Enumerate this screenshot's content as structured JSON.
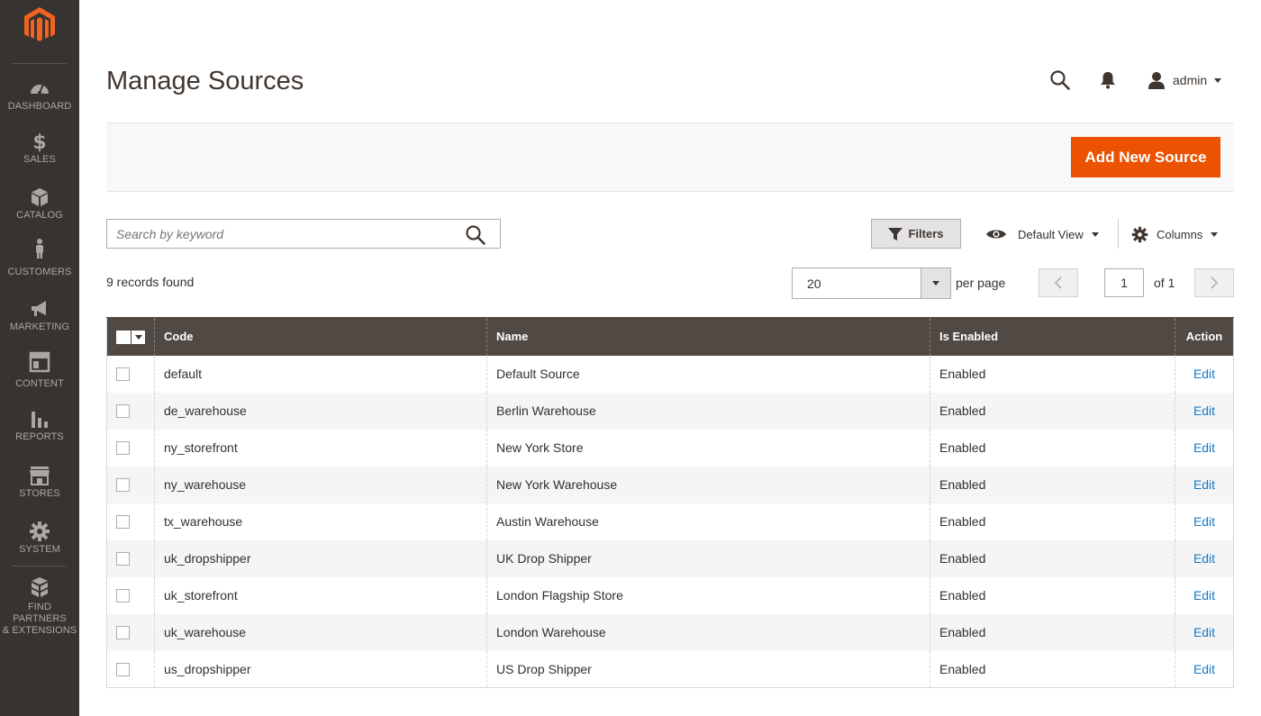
{
  "app": {
    "brand_color": "#eb5202",
    "sidebar_color": "#373330"
  },
  "sidebar": {
    "items": [
      {
        "label": "DASHBOARD",
        "icon": "dashboard-icon"
      },
      {
        "label": "SALES",
        "icon": "dollar-icon"
      },
      {
        "label": "CATALOG",
        "icon": "box-icon"
      },
      {
        "label": "CUSTOMERS",
        "icon": "person-icon"
      },
      {
        "label": "MARKETING",
        "icon": "megaphone-icon"
      },
      {
        "label": "CONTENT",
        "icon": "layout-icon"
      },
      {
        "label": "REPORTS",
        "icon": "bar-chart-icon"
      },
      {
        "label": "STORES",
        "icon": "storefront-icon"
      },
      {
        "label": "SYSTEM",
        "icon": "gear-icon"
      },
      {
        "label_line1": "FIND PARTNERS",
        "label_line2": "& EXTENSIONS",
        "icon": "blocks-icon"
      }
    ]
  },
  "header": {
    "title": "Manage Sources",
    "user": "admin"
  },
  "actions": {
    "add_label": "Add New Source"
  },
  "toolbar": {
    "search_placeholder": "Search by keyword",
    "filters_label": "Filters",
    "view_label": "Default View",
    "columns_label": "Columns"
  },
  "pager": {
    "records_text": "9 records found",
    "per_page_value": "20",
    "per_page_label": "per page",
    "current_page": "1",
    "of_text": "of 1"
  },
  "grid": {
    "columns": {
      "code": "Code",
      "name": "Name",
      "enabled": "Is Enabled",
      "action": "Action"
    },
    "rows": [
      {
        "code": "default",
        "name": "Default Source",
        "enabled": "Enabled",
        "action": "Edit"
      },
      {
        "code": "de_warehouse",
        "name": "Berlin Warehouse",
        "enabled": "Enabled",
        "action": "Edit"
      },
      {
        "code": "ny_storefront",
        "name": "New York Store",
        "enabled": "Enabled",
        "action": "Edit"
      },
      {
        "code": "ny_warehouse",
        "name": "New York Warehouse",
        "enabled": "Enabled",
        "action": "Edit"
      },
      {
        "code": "tx_warehouse",
        "name": "Austin Warehouse",
        "enabled": "Enabled",
        "action": "Edit"
      },
      {
        "code": "uk_dropshipper",
        "name": "UK Drop Shipper",
        "enabled": "Enabled",
        "action": "Edit"
      },
      {
        "code": "uk_storefront",
        "name": "London Flagship Store",
        "enabled": "Enabled",
        "action": "Edit"
      },
      {
        "code": "uk_warehouse",
        "name": "London Warehouse",
        "enabled": "Enabled",
        "action": "Edit"
      },
      {
        "code": "us_dropshipper",
        "name": "US Drop Shipper",
        "enabled": "Enabled",
        "action": "Edit"
      }
    ]
  }
}
